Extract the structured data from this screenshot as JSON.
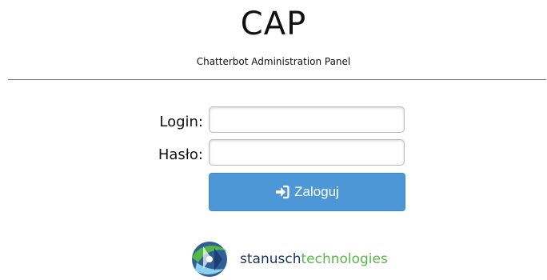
{
  "header": {
    "title": "CAP",
    "subtitle": "Chatterbot Administration Panel"
  },
  "form": {
    "login_label": "Login:",
    "password_label": "Hasło:",
    "login_value": "",
    "password_value": "",
    "submit_label": "Zaloguj",
    "submit_icon": "sign-in-icon",
    "accent": "#4e97d7"
  },
  "footer": {
    "brand_name_part1": "stanusch",
    "brand_name_part2": "technologies",
    "brand_color_dark": "#1b3566",
    "brand_color_green": "#57b747"
  }
}
